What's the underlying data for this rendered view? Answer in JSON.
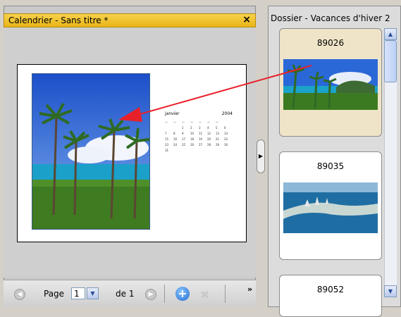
{
  "calendar_panel": {
    "title": "Calendrier - Sans titre *",
    "close_label": "×",
    "calendar": {
      "month": "janvier",
      "year": "2004",
      "weekday_headers": [
        "—",
        "—",
        "—",
        "—",
        "—",
        "—",
        "—"
      ],
      "days": [
        "",
        "",
        "",
        "1",
        "2",
        "3",
        "4",
        "5",
        "6",
        "7",
        "8",
        "9",
        "10",
        "11",
        "12",
        "13",
        "14",
        "15",
        "16",
        "17",
        "18",
        "19",
        "20",
        "21",
        "22",
        "23",
        "24",
        "25",
        "26",
        "27",
        "28",
        "29",
        "30",
        "31"
      ]
    }
  },
  "toolbar": {
    "page_label": "Page",
    "page_value": "1",
    "of_label": "de 1",
    "add_symbol": "+",
    "delete_symbol": "✖",
    "more_symbol": "»"
  },
  "folder_panel": {
    "title": "Dossier - Vacances d'hiver 2",
    "items": [
      {
        "id": "89026"
      },
      {
        "id": "89035"
      },
      {
        "id": "89052"
      }
    ]
  },
  "colors": {
    "titlebar": "#f2c22e",
    "arrow": "#e8202a",
    "selected_card": "#efe4c8"
  }
}
